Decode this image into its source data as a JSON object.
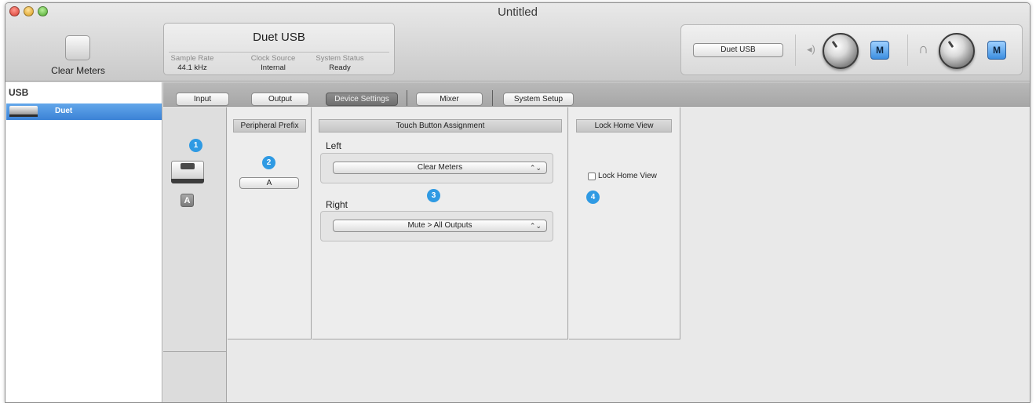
{
  "window": {
    "title": "Untitled"
  },
  "toolbar": {
    "clear_meters_label": "Clear Meters",
    "device": {
      "name": "Duet USB",
      "stats": [
        {
          "label": "Sample Rate",
          "value": "44.1 kHz"
        },
        {
          "label": "Clock Source",
          "value": "Internal"
        },
        {
          "label": "System Status",
          "value": "Ready"
        }
      ]
    },
    "output": {
      "device_select": "Duet USB",
      "speaker_mute_label": "M",
      "headphone_mute_label": "M",
      "speaker_icon": "speaker-icon",
      "headphone_icon": "headphones-icon"
    }
  },
  "sidebar": {
    "heading": "USB",
    "items": [
      {
        "label": "Duet",
        "selected": true
      }
    ]
  },
  "tabs": [
    {
      "label": "Input",
      "active": false
    },
    {
      "label": "Output",
      "active": false
    },
    {
      "label": "Device Settings",
      "active": true
    },
    {
      "label": "Mixer",
      "active": false
    },
    {
      "label": "System Setup",
      "active": false
    }
  ],
  "settings": {
    "device_badge_letter": "A",
    "peripheral_prefix": {
      "heading": "Peripheral Prefix",
      "value": "A"
    },
    "touch_assignment": {
      "heading": "Touch Button Assignment",
      "left_label": "Left",
      "left_value": "Clear Meters",
      "right_label": "Right",
      "right_value": "Mute > All Outputs",
      "select_arrows": "⌃⌄"
    },
    "lock_home_view": {
      "heading": "Lock Home View",
      "checkbox_label": "Lock Home View",
      "checked": false
    },
    "callouts": [
      "1",
      "2",
      "3",
      "4"
    ]
  },
  "colors": {
    "accent": "#3b82d6",
    "callout": "#2f9ae3",
    "mute_button": "#3c8ee0"
  }
}
